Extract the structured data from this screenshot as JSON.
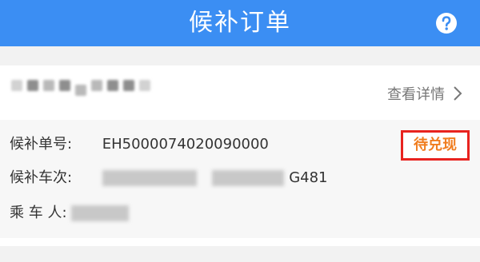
{
  "header": {
    "title": "候补订单",
    "help_icon": "question-circle-icon"
  },
  "order": {
    "detail_link": "查看详情",
    "detail_icon": "chevron-right-icon",
    "status": "待兑现",
    "fields": {
      "order_no_label": "候补单号:",
      "order_no_value": "EH5000074020090000",
      "train_label": "候补车次:",
      "train_visible_suffix": "G481",
      "passenger_label": "乘 车 人:"
    }
  },
  "colors": {
    "header_bg": "#3b8ef3",
    "status_text": "#f07d1f",
    "status_border": "#e8231f"
  }
}
